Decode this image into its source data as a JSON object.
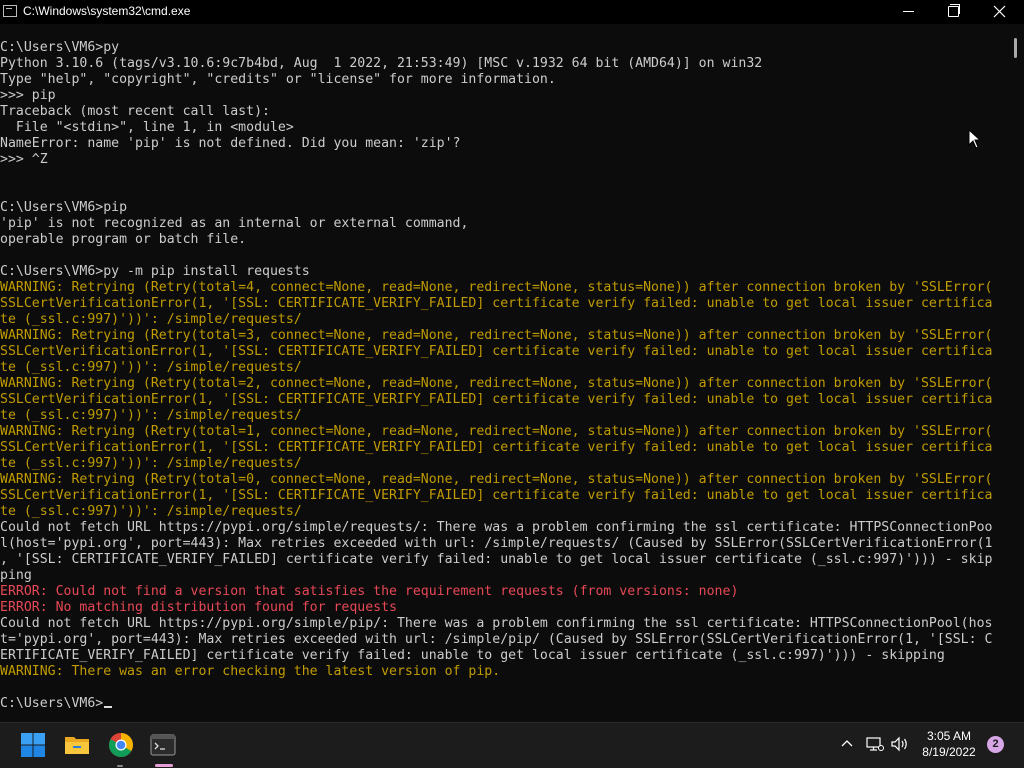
{
  "window": {
    "title": "C:\\Windows\\system32\\cmd.exe",
    "icon": "console-app-icon",
    "controls": [
      "minimize-icon",
      "maximize-icon",
      "close-icon"
    ]
  },
  "console": {
    "colors": {
      "normal": "#cccccc",
      "warning": "#c19c00",
      "error": "#e74856",
      "background": "#0c0c0c"
    },
    "lines": [
      {
        "text": "",
        "style": "normal"
      },
      {
        "text": "C:\\Users\\VM6>py",
        "style": "normal"
      },
      {
        "text": "Python 3.10.6 (tags/v3.10.6:9c7b4bd, Aug  1 2022, 21:53:49) [MSC v.1932 64 bit (AMD64)] on win32",
        "style": "normal"
      },
      {
        "text": "Type \"help\", \"copyright\", \"credits\" or \"license\" for more information.",
        "style": "normal"
      },
      {
        "text": ">>> pip",
        "style": "normal"
      },
      {
        "text": "Traceback (most recent call last):",
        "style": "normal"
      },
      {
        "text": "  File \"<stdin>\", line 1, in <module>",
        "style": "normal"
      },
      {
        "text": "NameError: name 'pip' is not defined. Did you mean: 'zip'?",
        "style": "normal"
      },
      {
        "text": ">>> ^Z",
        "style": "normal"
      },
      {
        "text": "",
        "style": "normal"
      },
      {
        "text": "",
        "style": "normal"
      },
      {
        "text": "C:\\Users\\VM6>pip",
        "style": "normal"
      },
      {
        "text": "'pip' is not recognized as an internal or external command,",
        "style": "normal"
      },
      {
        "text": "operable program or batch file.",
        "style": "normal"
      },
      {
        "text": "",
        "style": "normal"
      },
      {
        "text": "C:\\Users\\VM6>py -m pip install requests",
        "style": "normal"
      },
      {
        "text": "WARNING: Retrying (Retry(total=4, connect=None, read=None, redirect=None, status=None)) after connection broken by 'SSLError(",
        "style": "warn"
      },
      {
        "text": "SSLCertVerificationError(1, '[SSL: CERTIFICATE_VERIFY_FAILED] certificate verify failed: unable to get local issuer certifica",
        "style": "warn"
      },
      {
        "text": "te (_ssl.c:997)'))': /simple/requests/",
        "style": "warn"
      },
      {
        "text": "WARNING: Retrying (Retry(total=3, connect=None, read=None, redirect=None, status=None)) after connection broken by 'SSLError(",
        "style": "warn"
      },
      {
        "text": "SSLCertVerificationError(1, '[SSL: CERTIFICATE_VERIFY_FAILED] certificate verify failed: unable to get local issuer certifica",
        "style": "warn"
      },
      {
        "text": "te (_ssl.c:997)'))': /simple/requests/",
        "style": "warn"
      },
      {
        "text": "WARNING: Retrying (Retry(total=2, connect=None, read=None, redirect=None, status=None)) after connection broken by 'SSLError(",
        "style": "warn"
      },
      {
        "text": "SSLCertVerificationError(1, '[SSL: CERTIFICATE_VERIFY_FAILED] certificate verify failed: unable to get local issuer certifica",
        "style": "warn"
      },
      {
        "text": "te (_ssl.c:997)'))': /simple/requests/",
        "style": "warn"
      },
      {
        "text": "WARNING: Retrying (Retry(total=1, connect=None, read=None, redirect=None, status=None)) after connection broken by 'SSLError(",
        "style": "warn"
      },
      {
        "text": "SSLCertVerificationError(1, '[SSL: CERTIFICATE_VERIFY_FAILED] certificate verify failed: unable to get local issuer certifica",
        "style": "warn"
      },
      {
        "text": "te (_ssl.c:997)'))': /simple/requests/",
        "style": "warn"
      },
      {
        "text": "WARNING: Retrying (Retry(total=0, connect=None, read=None, redirect=None, status=None)) after connection broken by 'SSLError(",
        "style": "warn"
      },
      {
        "text": "SSLCertVerificationError(1, '[SSL: CERTIFICATE_VERIFY_FAILED] certificate verify failed: unable to get local issuer certifica",
        "style": "warn"
      },
      {
        "text": "te (_ssl.c:997)'))': /simple/requests/",
        "style": "warn"
      },
      {
        "text": "Could not fetch URL https://pypi.org/simple/requests/: There was a problem confirming the ssl certificate: HTTPSConnectionPoo",
        "style": "normal"
      },
      {
        "text": "l(host='pypi.org', port=443): Max retries exceeded with url: /simple/requests/ (Caused by SSLError(SSLCertVerificationError(1",
        "style": "normal"
      },
      {
        "text": ", '[SSL: CERTIFICATE_VERIFY_FAILED] certificate verify failed: unable to get local issuer certificate (_ssl.c:997)'))) - skip",
        "style": "normal"
      },
      {
        "text": "ping",
        "style": "normal"
      },
      {
        "text": "ERROR: Could not find a version that satisfies the requirement requests (from versions: none)",
        "style": "err"
      },
      {
        "text": "ERROR: No matching distribution found for requests",
        "style": "err"
      },
      {
        "text": "Could not fetch URL https://pypi.org/simple/pip/: There was a problem confirming the ssl certificate: HTTPSConnectionPool(hos",
        "style": "normal"
      },
      {
        "text": "t='pypi.org', port=443): Max retries exceeded with url: /simple/pip/ (Caused by SSLError(SSLCertVerificationError(1, '[SSL: C",
        "style": "normal"
      },
      {
        "text": "ERTIFICATE_VERIFY_FAILED] certificate verify failed: unable to get local issuer certificate (_ssl.c:997)'))) - skipping",
        "style": "normal"
      },
      {
        "text": "WARNING: There was an error checking the latest version of pip.",
        "style": "warn"
      },
      {
        "text": "",
        "style": "normal"
      },
      {
        "text": "C:\\Users\\VM6>",
        "style": "prompt"
      }
    ]
  },
  "taskbar": {
    "apps": [
      {
        "name": "start-icon"
      },
      {
        "name": "file-explorer-icon"
      },
      {
        "name": "chrome-icon"
      },
      {
        "name": "terminal-icon"
      }
    ],
    "tray": {
      "time": "3:05 AM",
      "date": "8/19/2022",
      "notification_count": "2"
    }
  }
}
